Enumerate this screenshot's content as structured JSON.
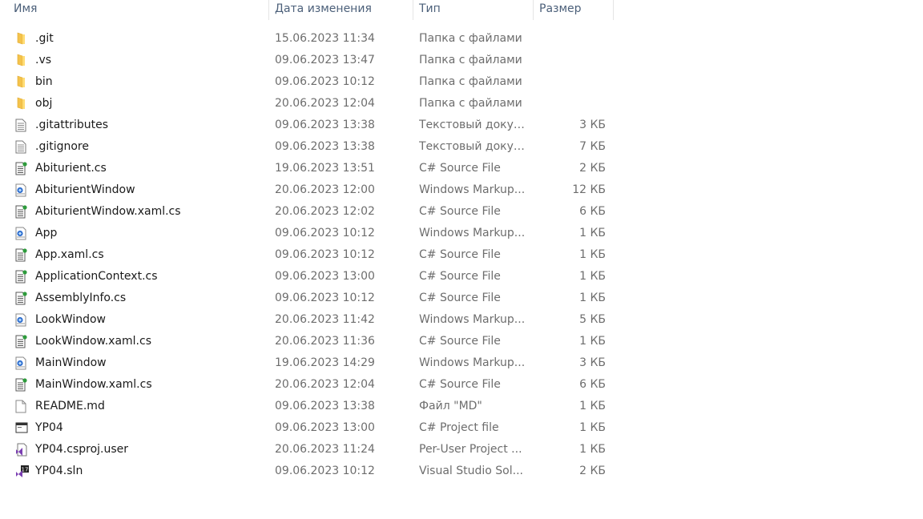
{
  "columns": {
    "name": "Имя",
    "date": "Дата изменения",
    "type": "Тип",
    "size": "Размер"
  },
  "files": [
    {
      "name": ".git",
      "date": "15.06.2023 11:34",
      "type": "Папка с файлами",
      "size": "",
      "icon": "folder-icon"
    },
    {
      "name": ".vs",
      "date": "09.06.2023 13:47",
      "type": "Папка с файлами",
      "size": "",
      "icon": "folder-icon"
    },
    {
      "name": "bin",
      "date": "09.06.2023 10:12",
      "type": "Папка с файлами",
      "size": "",
      "icon": "folder-icon"
    },
    {
      "name": "obj",
      "date": "20.06.2023 12:04",
      "type": "Папка с файлами",
      "size": "",
      "icon": "folder-icon"
    },
    {
      "name": ".gitattributes",
      "date": "09.06.2023 13:38",
      "type": "Текстовый докум...",
      "size": "3 КБ",
      "icon": "text-file-icon"
    },
    {
      "name": ".gitignore",
      "date": "09.06.2023 13:38",
      "type": "Текстовый докум...",
      "size": "7 КБ",
      "icon": "text-file-icon"
    },
    {
      "name": "Abiturient.cs",
      "date": "19.06.2023 13:51",
      "type": "C# Source File",
      "size": "2 КБ",
      "icon": "csharp-file-icon"
    },
    {
      "name": "AbiturientWindow",
      "date": "20.06.2023 12:00",
      "type": "Windows Markup...",
      "size": "12 КБ",
      "icon": "xaml-file-icon"
    },
    {
      "name": "AbiturientWindow.xaml.cs",
      "date": "20.06.2023 12:02",
      "type": "C# Source File",
      "size": "6 КБ",
      "icon": "csharp-file-icon"
    },
    {
      "name": "App",
      "date": "09.06.2023 10:12",
      "type": "Windows Markup...",
      "size": "1 КБ",
      "icon": "xaml-file-icon"
    },
    {
      "name": "App.xaml.cs",
      "date": "09.06.2023 10:12",
      "type": "C# Source File",
      "size": "1 КБ",
      "icon": "csharp-file-icon"
    },
    {
      "name": "ApplicationContext.cs",
      "date": "09.06.2023 13:00",
      "type": "C# Source File",
      "size": "1 КБ",
      "icon": "csharp-file-icon"
    },
    {
      "name": "AssemblyInfo.cs",
      "date": "09.06.2023 10:12",
      "type": "C# Source File",
      "size": "1 КБ",
      "icon": "csharp-file-icon"
    },
    {
      "name": "LookWindow",
      "date": "20.06.2023 11:42",
      "type": "Windows Markup...",
      "size": "5 КБ",
      "icon": "xaml-file-icon"
    },
    {
      "name": "LookWindow.xaml.cs",
      "date": "20.06.2023 11:36",
      "type": "C# Source File",
      "size": "1 КБ",
      "icon": "csharp-file-icon"
    },
    {
      "name": "MainWindow",
      "date": "19.06.2023 14:29",
      "type": "Windows Markup...",
      "size": "3 КБ",
      "icon": "xaml-file-icon"
    },
    {
      "name": "MainWindow.xaml.cs",
      "date": "20.06.2023 12:04",
      "type": "C# Source File",
      "size": "6 КБ",
      "icon": "csharp-file-icon"
    },
    {
      "name": "README.md",
      "date": "09.06.2023 13:38",
      "type": "Файл \"MD\"",
      "size": "1 КБ",
      "icon": "blank-file-icon"
    },
    {
      "name": "YP04",
      "date": "09.06.2023 13:00",
      "type": "C# Project file",
      "size": "1 КБ",
      "icon": "project-file-icon"
    },
    {
      "name": "YP04.csproj.user",
      "date": "20.06.2023 11:24",
      "type": "Per-User Project ...",
      "size": "1 КБ",
      "icon": "visual-studio-file-icon"
    },
    {
      "name": "YP04.sln",
      "date": "09.06.2023 10:12",
      "type": "Visual Studio Sol...",
      "size": "2 КБ",
      "icon": "solution-file-icon"
    }
  ]
}
